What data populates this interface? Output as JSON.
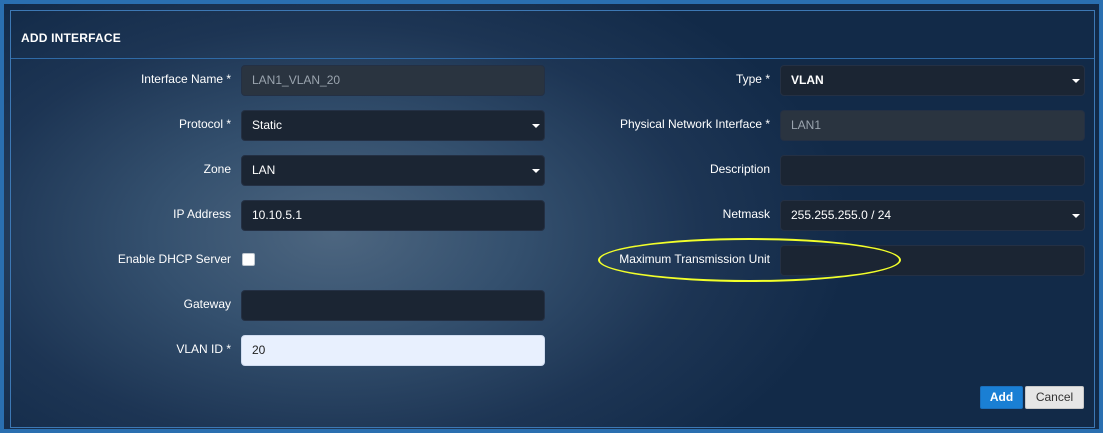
{
  "header": {
    "title": "ADD INTERFACE"
  },
  "left": {
    "interface_name": {
      "label": "Interface Name *",
      "value": "LAN1_VLAN_20"
    },
    "protocol": {
      "label": "Protocol *",
      "value": "Static"
    },
    "zone": {
      "label": "Zone",
      "value": "LAN"
    },
    "ip_address": {
      "label": "IP Address",
      "value": "10.10.5.1"
    },
    "enable_dhcp": {
      "label": "Enable DHCP Server",
      "checked": false
    },
    "gateway": {
      "label": "Gateway",
      "value": ""
    },
    "vlan_id": {
      "label": "VLAN ID *",
      "value": "20"
    }
  },
  "right": {
    "type": {
      "label": "Type *",
      "value": "VLAN"
    },
    "physical_interface": {
      "label": "Physical Network Interface *",
      "value": "LAN1"
    },
    "description": {
      "label": "Description",
      "value": ""
    },
    "netmask": {
      "label": "Netmask",
      "value": "255.255.255.0 / 24"
    },
    "mtu": {
      "label": "Maximum Transmission Unit",
      "value": ""
    }
  },
  "buttons": {
    "add": "Add",
    "cancel": "Cancel"
  },
  "colors": {
    "highlight": "#f2ff2a",
    "accent": "#1a7fd4",
    "border": "#2a6fb0"
  },
  "icons": {
    "dropdown": "caret-down-icon"
  }
}
